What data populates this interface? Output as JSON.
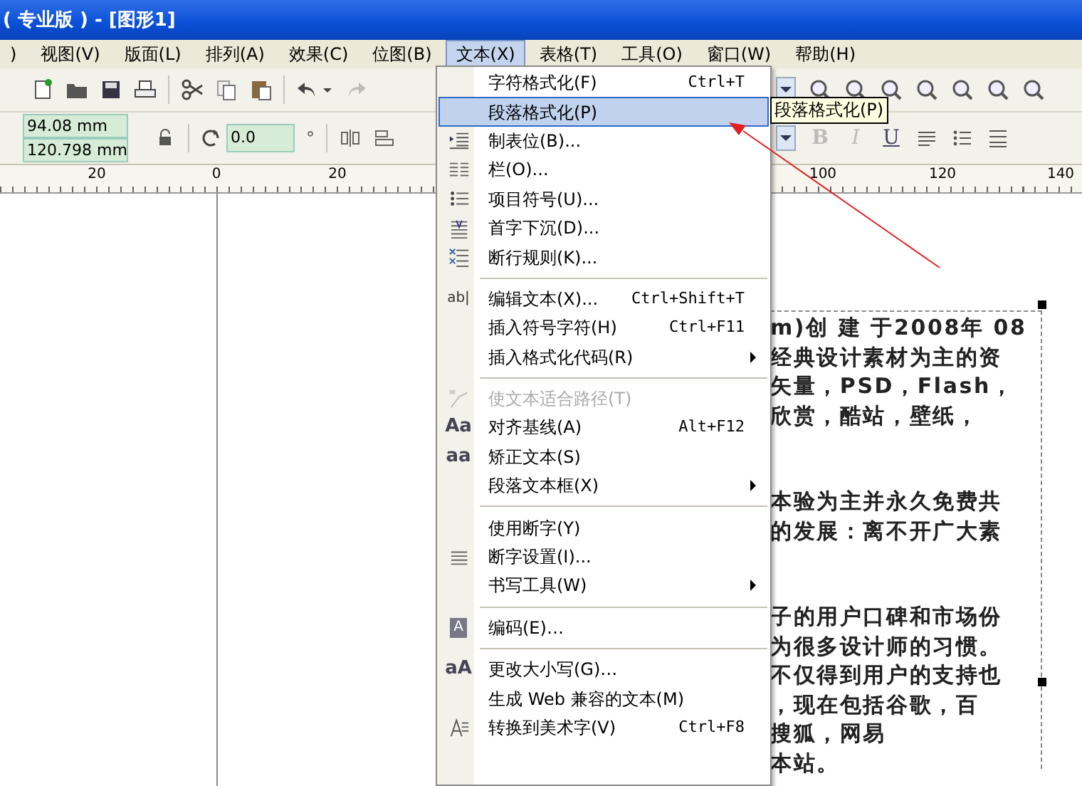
{
  "window": {
    "title": "( 专业版 ) - [图形1]"
  },
  "menubar": [
    {
      "label": ")",
      "selected": false
    },
    {
      "label": "视图(V)",
      "selected": false
    },
    {
      "label": "版面(L)",
      "selected": false
    },
    {
      "label": "排列(A)",
      "selected": false
    },
    {
      "label": "效果(C)",
      "selected": false
    },
    {
      "label": "位图(B)",
      "selected": false
    },
    {
      "label": "文本(X)",
      "selected": true
    },
    {
      "label": "表格(T)",
      "selected": false
    },
    {
      "label": "工具(O)",
      "selected": false
    },
    {
      "label": "窗口(W)",
      "selected": false
    },
    {
      "label": "帮助(H)",
      "selected": false
    }
  ],
  "property_bar": {
    "width": "94.08 mm",
    "height": "120.798 mm",
    "rotation": "0.0",
    "degree_symbol": "°",
    "format_buttons": [
      "B",
      "I",
      "U"
    ]
  },
  "ruler": {
    "labels": [
      "20",
      "0",
      "20",
      "100",
      "120",
      "140"
    ]
  },
  "menu": {
    "items": [
      {
        "kind": "item",
        "label": "字符格式化(F)",
        "shortcut": "Ctrl+T",
        "selected": false,
        "disabled": false,
        "submenu": false
      },
      {
        "kind": "item",
        "label": "段落格式化(P)",
        "selected": true,
        "disabled": false,
        "submenu": false
      },
      {
        "kind": "item",
        "label": "制表位(B)...",
        "selected": false,
        "disabled": false,
        "submenu": false
      },
      {
        "kind": "item",
        "label": "栏(O)...",
        "selected": false,
        "disabled": false,
        "submenu": false
      },
      {
        "kind": "item",
        "label": "项目符号(U)...",
        "selected": false,
        "disabled": false,
        "submenu": false
      },
      {
        "kind": "item",
        "label": "首字下沉(D)...",
        "selected": false,
        "disabled": false,
        "submenu": false
      },
      {
        "kind": "item",
        "label": "断行规则(K)...",
        "selected": false,
        "disabled": false,
        "submenu": false
      },
      {
        "kind": "separator"
      },
      {
        "kind": "item",
        "label": "编辑文本(X)...",
        "shortcut": "Ctrl+Shift+T",
        "icon_text": "ab|",
        "selected": false,
        "disabled": false,
        "submenu": false
      },
      {
        "kind": "item",
        "label": "插入符号字符(H)",
        "shortcut": "Ctrl+F11",
        "selected": false,
        "disabled": false,
        "submenu": false
      },
      {
        "kind": "item",
        "label": "插入格式化代码(R)",
        "selected": false,
        "disabled": false,
        "submenu": true
      },
      {
        "kind": "separator"
      },
      {
        "kind": "item",
        "label": "使文本适合路径(T)",
        "selected": false,
        "disabled": true,
        "submenu": false
      },
      {
        "kind": "item",
        "label": "对齐基线(A)",
        "shortcut": "Alt+F12",
        "icon_text": "Aa",
        "selected": false,
        "disabled": false,
        "submenu": false
      },
      {
        "kind": "item",
        "label": "矫正文本(S)",
        "icon_text": "aa",
        "selected": false,
        "disabled": false,
        "submenu": false
      },
      {
        "kind": "item",
        "label": "段落文本框(X)",
        "selected": false,
        "disabled": false,
        "submenu": true
      },
      {
        "kind": "separator"
      },
      {
        "kind": "item",
        "label": "使用断字(Y)",
        "selected": false,
        "disabled": false,
        "submenu": false
      },
      {
        "kind": "item",
        "label": "断字设置(I)...",
        "selected": false,
        "disabled": false,
        "submenu": false
      },
      {
        "kind": "item",
        "label": "书写工具(W)",
        "selected": false,
        "disabled": false,
        "submenu": true
      },
      {
        "kind": "separator"
      },
      {
        "kind": "item",
        "label": "编码(E)…",
        "icon_text": "A",
        "selected": false,
        "disabled": false,
        "submenu": false
      },
      {
        "kind": "separator"
      },
      {
        "kind": "item",
        "label": "更改大小写(G)…",
        "icon_text": "aA",
        "selected": false,
        "disabled": false,
        "submenu": false
      },
      {
        "kind": "item",
        "label": "生成 Web 兼容的文本(M)",
        "selected": false,
        "disabled": false,
        "submenu": false
      },
      {
        "kind": "item",
        "label": "转换到美术字(V)",
        "shortcut": "Ctrl+F8",
        "selected": false,
        "disabled": false,
        "submenu": false
      }
    ]
  },
  "tooltip": "段落格式化(P)",
  "document_text": {
    "paragraphs": [
      {
        "lines": [
          "m)创 建 于2008年 08",
          "经典设计素材为主的资",
          "矢量，PSD，Flash，",
          "欣赏，酷站，壁纸，"
        ]
      },
      {
        "lines": [
          "本验为主并永久免费共",
          "的发展：离不开广大素"
        ]
      },
      {
        "lines": [
          "子的用户口碑和市场份",
          "为很多设计师的习惯。",
          "不仅得到用户的支持也",
          "，现在包括谷歌，百",
          "搜狐，网易",
          "本站。"
        ]
      }
    ]
  }
}
